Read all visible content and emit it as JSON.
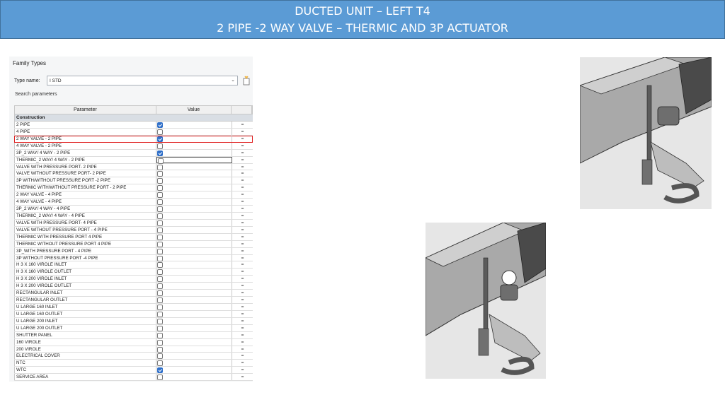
{
  "banner": {
    "line1": "DUCTED UNIT – LEFT T4",
    "line2": "2 PIPE -2 WAY VALVE – THERMIC AND  3P ACTUATOR"
  },
  "dialog": {
    "title": "Family Types",
    "type_name_label": "Type name:",
    "type_name_value": "I STD",
    "search_label": "Search parameters",
    "columns": {
      "parameter": "Parameter",
      "value": "Value",
      "formula": ""
    },
    "group": "Construction",
    "rows": [
      {
        "label": "2 PIPE",
        "checked": true
      },
      {
        "label": "4 PIPE",
        "checked": false
      },
      {
        "label": "2 WAY  VALVE - 2 PIPE",
        "checked": true,
        "highlight": true
      },
      {
        "label": "4 WAY VALVE - 2 PIPE",
        "checked": false
      },
      {
        "label": "3P_2 WAY/ 4 WAY - 2 PIPE",
        "checked": true
      },
      {
        "label": "THERMIC_2 WAY/ 4 WAY - 2 PIPE",
        "checked": false,
        "selected": true
      },
      {
        "label": "VALVE WITH PRESSURE PORT- 2 PIPE",
        "checked": false
      },
      {
        "label": "VALVE WITHOUT PRESSURE PORT- 2  PIPE",
        "checked": false
      },
      {
        "label": "3P WITH/WITHOUT PRESSURE PORT -2 PIPE",
        "checked": false
      },
      {
        "label": "THERMIC WITH/WITHOUT PRESSURE PORT - 2 PIPE",
        "checked": false
      },
      {
        "label": "2 WAY VALVE - 4 PIPE",
        "checked": false
      },
      {
        "label": "4 WAY VALVE - 4 PIPE",
        "checked": false
      },
      {
        "label": "3P_2 WAY/ 4 WAY - 4 PIPE",
        "checked": false
      },
      {
        "label": "THERMIC_2 WAY/ 4 WAY - 4 PIPE",
        "checked": false
      },
      {
        "label": "VALVE WITH PRESSURE PORT- 4 PIPE",
        "checked": false
      },
      {
        "label": "VALVE WITHOUT PRESSURE PORT - 4 PIPE",
        "checked": false
      },
      {
        "label": "THERMIC WITH PRESSURE PORT 4 PIPE",
        "checked": false
      },
      {
        "label": "THERMIC WITHOUT PRESSURE PORT  4 PIPE",
        "checked": false
      },
      {
        "label": "3P_WITH PRESSURE PORT - 4 PIPE",
        "checked": false
      },
      {
        "label": "3P WITHOUT PRESSURE PORT -4  PIPE",
        "checked": false
      },
      {
        "label": "H  3 X 160 VIROLE INLET",
        "checked": false
      },
      {
        "label": "H  3 X 160 VIROLE OUTLET",
        "checked": false
      },
      {
        "label": "H  3 X 200 VIROLE INLET",
        "checked": false
      },
      {
        "label": "H  3 X 200 VIROLE OUTLET",
        "checked": false
      },
      {
        "label": "RECTANGULAR INLET",
        "checked": false
      },
      {
        "label": "RECTANGULAR OUTLET",
        "checked": false
      },
      {
        "label": "U LARGE 160 INLET",
        "checked": false
      },
      {
        "label": "U LARGE 160 OUTLET",
        "checked": false
      },
      {
        "label": "U LARGE 200 INLET",
        "checked": false
      },
      {
        "label": "U LARGE 200 OUTLET",
        "checked": false
      },
      {
        "label": "SHUTTER PANEL",
        "checked": false
      },
      {
        "label": "160 VIROLE",
        "checked": false
      },
      {
        "label": "200 VIROLE",
        "checked": false
      },
      {
        "label": "ELECTRICAL COVER",
        "checked": false
      },
      {
        "label": "NTC",
        "checked": false
      },
      {
        "label": "WTC",
        "checked": true
      },
      {
        "label": "SERVICE AREA",
        "checked": false
      }
    ],
    "formula_symbol": "="
  }
}
